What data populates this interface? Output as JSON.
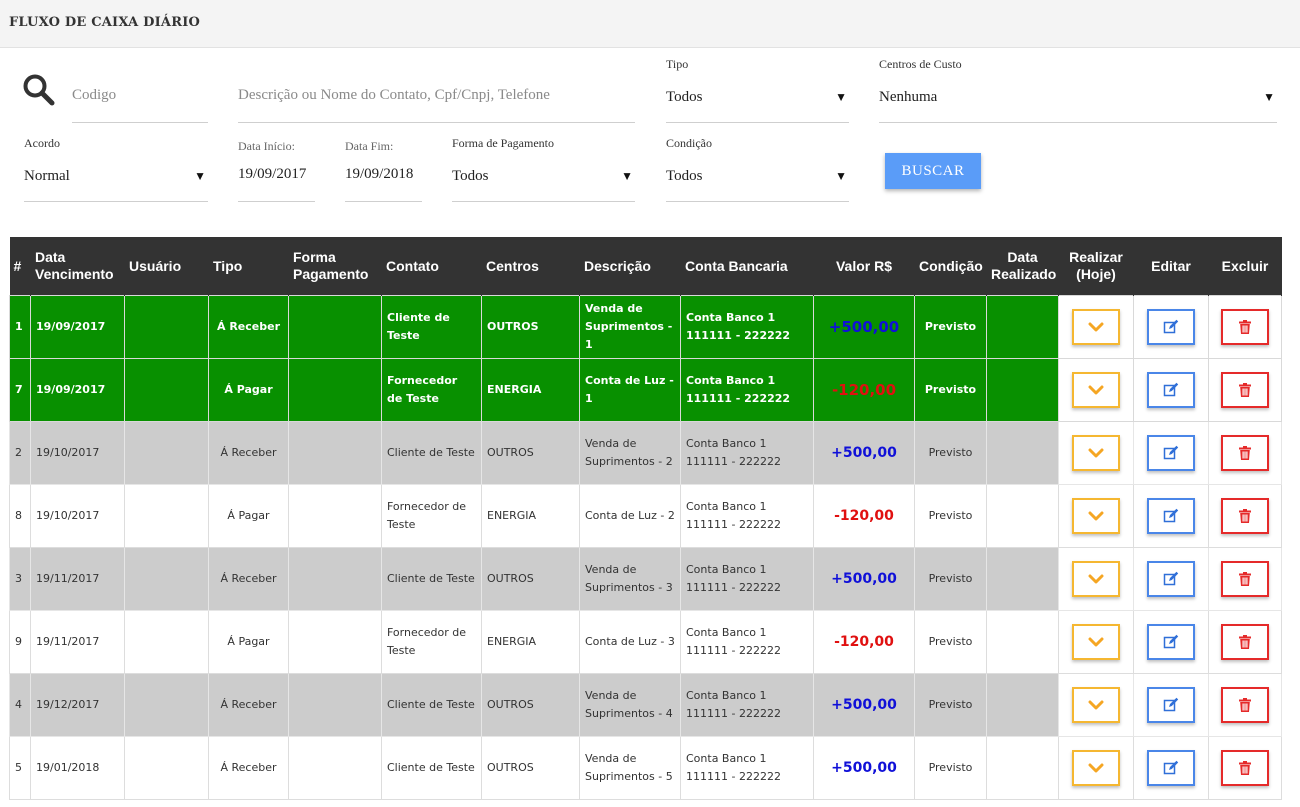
{
  "page_title": "FLUXO DE CAIXA DIÁRIO",
  "filters": {
    "codigo_placeholder": "Codigo",
    "descricao_placeholder": "Descrição ou Nome do Contato, Cpf/Cnpj, Telefone",
    "tipo_label": "Tipo",
    "tipo_value": "Todos",
    "centros_label": "Centros de Custo",
    "centros_value": "Nenhuma",
    "acordo_label": "Acordo",
    "acordo_value": "Normal",
    "data_inicio_label": "Data Início:",
    "data_inicio_value": "19/09/2017",
    "data_fim_label": "Data Fim:",
    "data_fim_value": "19/09/2018",
    "forma_label": "Forma de Pagamento",
    "forma_value": "Todos",
    "condicao_label": "Condição",
    "condicao_value": "Todos",
    "buscar_label": "BUSCAR"
  },
  "table": {
    "headers": {
      "num": "#",
      "data_venc_1": "Data",
      "data_venc_2": "Vencimento",
      "usuario": "Usuário",
      "tipo": "Tipo",
      "forma_1": "Forma",
      "forma_2": "Pagamento",
      "contato": "Contato",
      "centros": "Centros",
      "descricao": "Descrição",
      "conta": "Conta Bancaria",
      "valor": "Valor R$",
      "condicao": "Condição",
      "data_real_1": "Data",
      "data_real_2": "Realizado",
      "realizar_1": "Realizar",
      "realizar_2": "(Hoje)",
      "editar": "Editar",
      "excluir": "Excluir"
    },
    "rows": [
      {
        "num": "1",
        "data": "19/09/2017",
        "usuario": "",
        "tipo": "Á Receber",
        "forma": "",
        "contato": "Cliente de Teste",
        "centros": "OUTROS",
        "desc1": "Venda de",
        "desc2": "Suprimentos - 1",
        "conta1": "Conta Banco 1",
        "conta2": "111111 - 222222",
        "valor": "+500,00",
        "sign": "pos",
        "condicao": "Previsto",
        "data_real": "",
        "style": "green"
      },
      {
        "num": "7",
        "data": "19/09/2017",
        "usuario": "",
        "tipo": "Á Pagar",
        "forma": "",
        "contato": "Fornecedor de Teste",
        "centros": "ENERGIA",
        "desc1": "Conta de Luz - 1",
        "desc2": "",
        "conta1": "Conta Banco 1",
        "conta2": "111111 - 222222",
        "valor": "-120,00",
        "sign": "neg",
        "condicao": "Previsto",
        "data_real": "",
        "style": "green"
      },
      {
        "num": "2",
        "data": "19/10/2017",
        "usuario": "",
        "tipo": "Á Receber",
        "forma": "",
        "contato": "Cliente de Teste",
        "centros": "OUTROS",
        "desc1": "Venda de",
        "desc2": "Suprimentos - 2",
        "conta1": "Conta Banco 1",
        "conta2": "111111 - 222222",
        "valor": "+500,00",
        "sign": "pos",
        "condicao": "Previsto",
        "data_real": "",
        "style": "gray"
      },
      {
        "num": "8",
        "data": "19/10/2017",
        "usuario": "",
        "tipo": "Á Pagar",
        "forma": "",
        "contato": "Fornecedor de Teste",
        "centros": "ENERGIA",
        "desc1": "Conta de Luz - 2",
        "desc2": "",
        "conta1": "Conta Banco 1",
        "conta2": "111111 - 222222",
        "valor": "-120,00",
        "sign": "neg",
        "condicao": "Previsto",
        "data_real": "",
        "style": "white"
      },
      {
        "num": "3",
        "data": "19/11/2017",
        "usuario": "",
        "tipo": "Á Receber",
        "forma": "",
        "contato": "Cliente de Teste",
        "centros": "OUTROS",
        "desc1": "Venda de",
        "desc2": "Suprimentos - 3",
        "conta1": "Conta Banco 1",
        "conta2": "111111 - 222222",
        "valor": "+500,00",
        "sign": "pos",
        "condicao": "Previsto",
        "data_real": "",
        "style": "gray"
      },
      {
        "num": "9",
        "data": "19/11/2017",
        "usuario": "",
        "tipo": "Á Pagar",
        "forma": "",
        "contato": "Fornecedor de Teste",
        "centros": "ENERGIA",
        "desc1": "Conta de Luz - 3",
        "desc2": "",
        "conta1": "Conta Banco 1",
        "conta2": "111111 - 222222",
        "valor": "-120,00",
        "sign": "neg",
        "condicao": "Previsto",
        "data_real": "",
        "style": "white"
      },
      {
        "num": "4",
        "data": "19/12/2017",
        "usuario": "",
        "tipo": "Á Receber",
        "forma": "",
        "contato": "Cliente de Teste",
        "centros": "OUTROS",
        "desc1": "Venda de",
        "desc2": "Suprimentos - 4",
        "conta1": "Conta Banco 1",
        "conta2": "111111 - 222222",
        "valor": "+500,00",
        "sign": "pos",
        "condicao": "Previsto",
        "data_real": "",
        "style": "gray"
      },
      {
        "num": "5",
        "data": "19/01/2018",
        "usuario": "",
        "tipo": "Á Receber",
        "forma": "",
        "contato": "Cliente de Teste",
        "centros": "OUTROS",
        "desc1": "Venda de",
        "desc2": "Suprimentos - 5",
        "conta1": "Conta Banco 1",
        "conta2": "111111 - 222222",
        "valor": "+500,00",
        "sign": "pos",
        "condicao": "Previsto",
        "data_real": "",
        "style": "white"
      }
    ]
  },
  "colors": {
    "green_row": "#089000",
    "gray_row": "#cccccc",
    "header_bg": "#333333",
    "buscar_bg": "#5a9cf8",
    "positive": "#1010d8",
    "negative": "#e01010",
    "realizar_border": "#f5b731",
    "editar_border": "#4a86e8",
    "excluir_border": "#e52a2a"
  },
  "icons": {
    "search": "search-icon",
    "realizar": "chevron-down-icon",
    "editar": "edit-icon",
    "excluir": "trash-icon"
  }
}
